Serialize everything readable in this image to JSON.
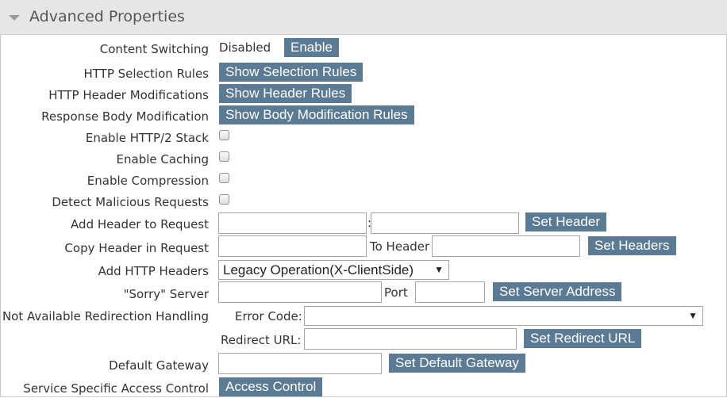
{
  "section": {
    "title": "Advanced Properties",
    "collapse_icon": "triangle-down-icon"
  },
  "content_switching": {
    "label": "Content Switching",
    "status": "Disabled",
    "button": "Enable"
  },
  "http_selection_rules": {
    "label": "HTTP Selection Rules",
    "button": "Show Selection Rules"
  },
  "http_header_modifications": {
    "label": "HTTP Header Modifications",
    "button": "Show Header Rules"
  },
  "response_body_modification": {
    "label": "Response Body Modification",
    "button": "Show Body Modification Rules"
  },
  "enable_http2": {
    "label": "Enable HTTP/2 Stack",
    "checked": false
  },
  "enable_caching": {
    "label": "Enable Caching",
    "checked": false
  },
  "enable_compression": {
    "label": "Enable Compression",
    "checked": false
  },
  "detect_malicious": {
    "label": "Detect Malicious Requests",
    "checked": false
  },
  "add_header": {
    "label": "Add Header to Request",
    "name_value": "",
    "separator": ":",
    "value_value": "",
    "button": "Set Header"
  },
  "copy_header": {
    "label": "Copy Header in Request",
    "source_value": "",
    "to_label": "To Header",
    "target_value": "",
    "button": "Set Headers"
  },
  "add_http_headers": {
    "label": "Add HTTP Headers",
    "selected": "Legacy Operation(X-ClientSide)"
  },
  "sorry_server": {
    "label": "\"Sorry\" Server",
    "address_value": "",
    "port_label": "Port",
    "port_value": "",
    "button": "Set Server Address"
  },
  "not_available": {
    "label": "Not Available Redirection Handling",
    "error_code_label": "Error Code:",
    "error_code_selected": "",
    "redirect_url_label": "Redirect URL:",
    "redirect_url_value": "",
    "button": "Set Redirect URL"
  },
  "default_gateway": {
    "label": "Default Gateway",
    "value": "",
    "button": "Set Default Gateway"
  },
  "access_control": {
    "label": "Service Specific Access Control",
    "button": "Access Control"
  }
}
